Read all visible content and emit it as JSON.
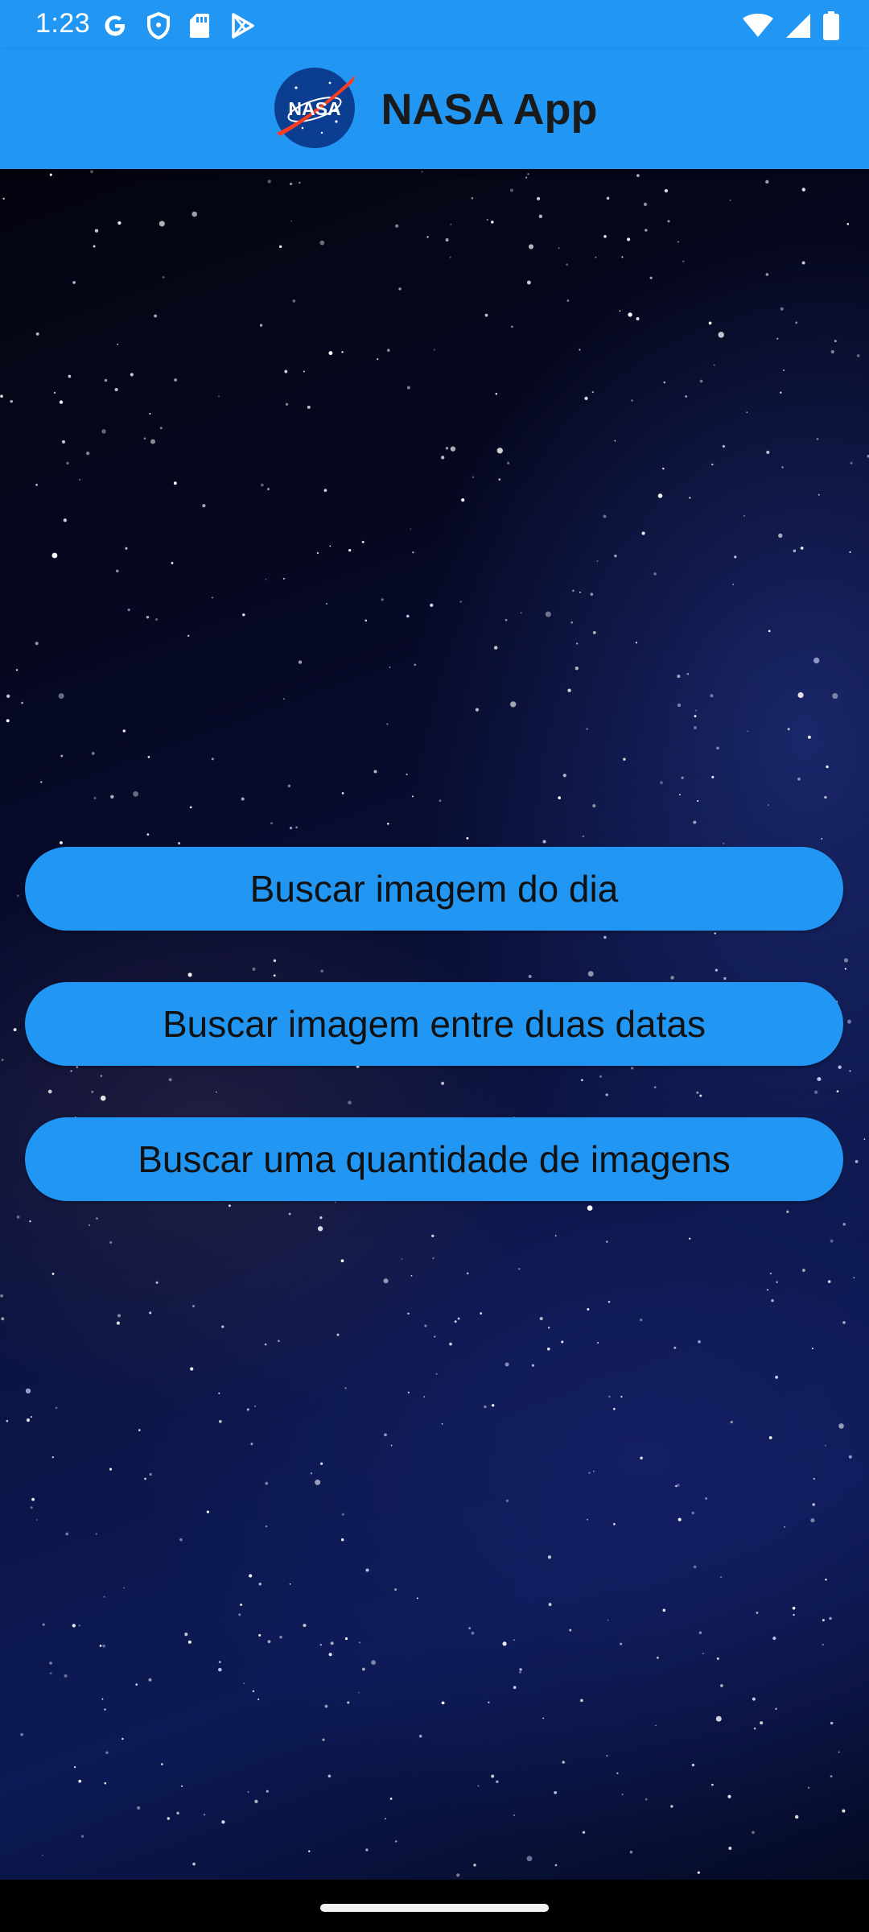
{
  "status_bar": {
    "time": "1:23",
    "left_icons": [
      "google-icon",
      "shield-icon",
      "sd-card-icon",
      "play-store-icon"
    ],
    "right_icons": [
      "wifi-icon",
      "signal-icon",
      "battery-icon"
    ]
  },
  "app_bar": {
    "logo_text": "NASA",
    "title": "NASA App"
  },
  "buttons": {
    "daily_image": "Buscar imagem do dia",
    "between_dates": "Buscar imagem entre duas datas",
    "image_quantity": "Buscar uma quantidade de imagens"
  },
  "colors": {
    "primary": "#2196F3",
    "button_text": "#111111",
    "background_dark": "#070a2a"
  }
}
